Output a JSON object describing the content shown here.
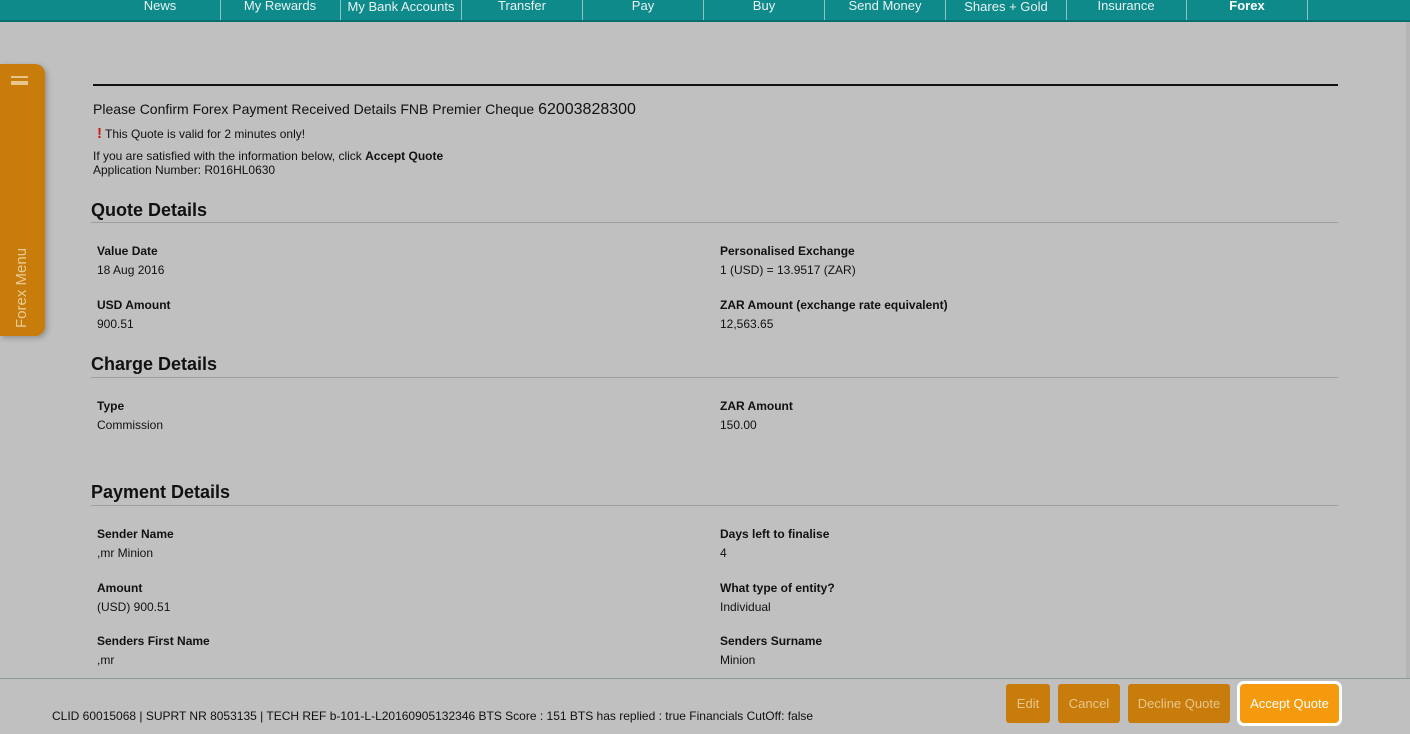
{
  "nav": {
    "items": [
      {
        "label": "News",
        "active": false
      },
      {
        "label": "My Rewards",
        "active": false
      },
      {
        "label": "My Bank Accounts",
        "active": false
      },
      {
        "label": "Transfer",
        "active": false
      },
      {
        "label": "Pay",
        "active": false
      },
      {
        "label": "Buy",
        "active": false
      },
      {
        "label": "Send Money",
        "active": false
      },
      {
        "label": "Shares + Gold",
        "active": false
      },
      {
        "label": "Insurance",
        "active": false
      },
      {
        "label": "Forex",
        "active": true
      }
    ]
  },
  "side_menu": {
    "label": "Forex Menu",
    "icon": "hamburger-icon"
  },
  "intro": {
    "confirm_text": "Please Confirm Forex Payment Received Details FNB Premier Cheque",
    "account_number": "62003828300",
    "warning_mark": "!",
    "valid_text": "This Quote is valid for 2 minutes only!",
    "satisfied_text": "If you are satisfied with the information below, click",
    "satisfied_bold": "Accept Quote",
    "application_number": "Application Number: R016HL0630"
  },
  "quote_details": {
    "title": "Quote Details",
    "value_date_label": "Value Date",
    "value_date": "18 Aug 2016",
    "exchange_label": "Personalised Exchange",
    "exchange_value": "1 (USD) = 13.9517 (ZAR)",
    "usd_amount_label": "USD Amount",
    "usd_amount": "900.51",
    "zar_amount_label": "ZAR Amount (exchange rate equivalent)",
    "zar_amount": "12,563.65"
  },
  "charge_details": {
    "title": "Charge Details",
    "type_label": "Type",
    "type_value": "Commission",
    "zar_label": "ZAR Amount",
    "zar_value": "150.00"
  },
  "payment_details": {
    "title": "Payment Details",
    "sender_name_label": "Sender Name",
    "sender_name": ",mr Minion",
    "days_left_label": "Days left to finalise",
    "days_left": "4",
    "amount_label": "Amount",
    "amount": "(USD) 900.51",
    "entity_label": "What type of entity?",
    "entity": "Individual",
    "first_name_label": "Senders First Name",
    "first_name": ",mr",
    "surname_label": "Senders Surname",
    "surname": "Minion"
  },
  "footer": {
    "info": "CLID 60015068 | SUPRT NR 8053135 | TECH REF b-101-L-L20160905132346 BTS Score : 151 BTS has replied : true Financials CutOff: false",
    "edit": "Edit",
    "cancel": "Cancel",
    "decline": "Decline Quote",
    "accept": "Accept Quote"
  },
  "colors": {
    "nav_bg": "#0f8a8a",
    "accent_orange": "#c77c0b",
    "primary_orange": "#f49a0c",
    "page_bg": "#c0c0c0"
  }
}
